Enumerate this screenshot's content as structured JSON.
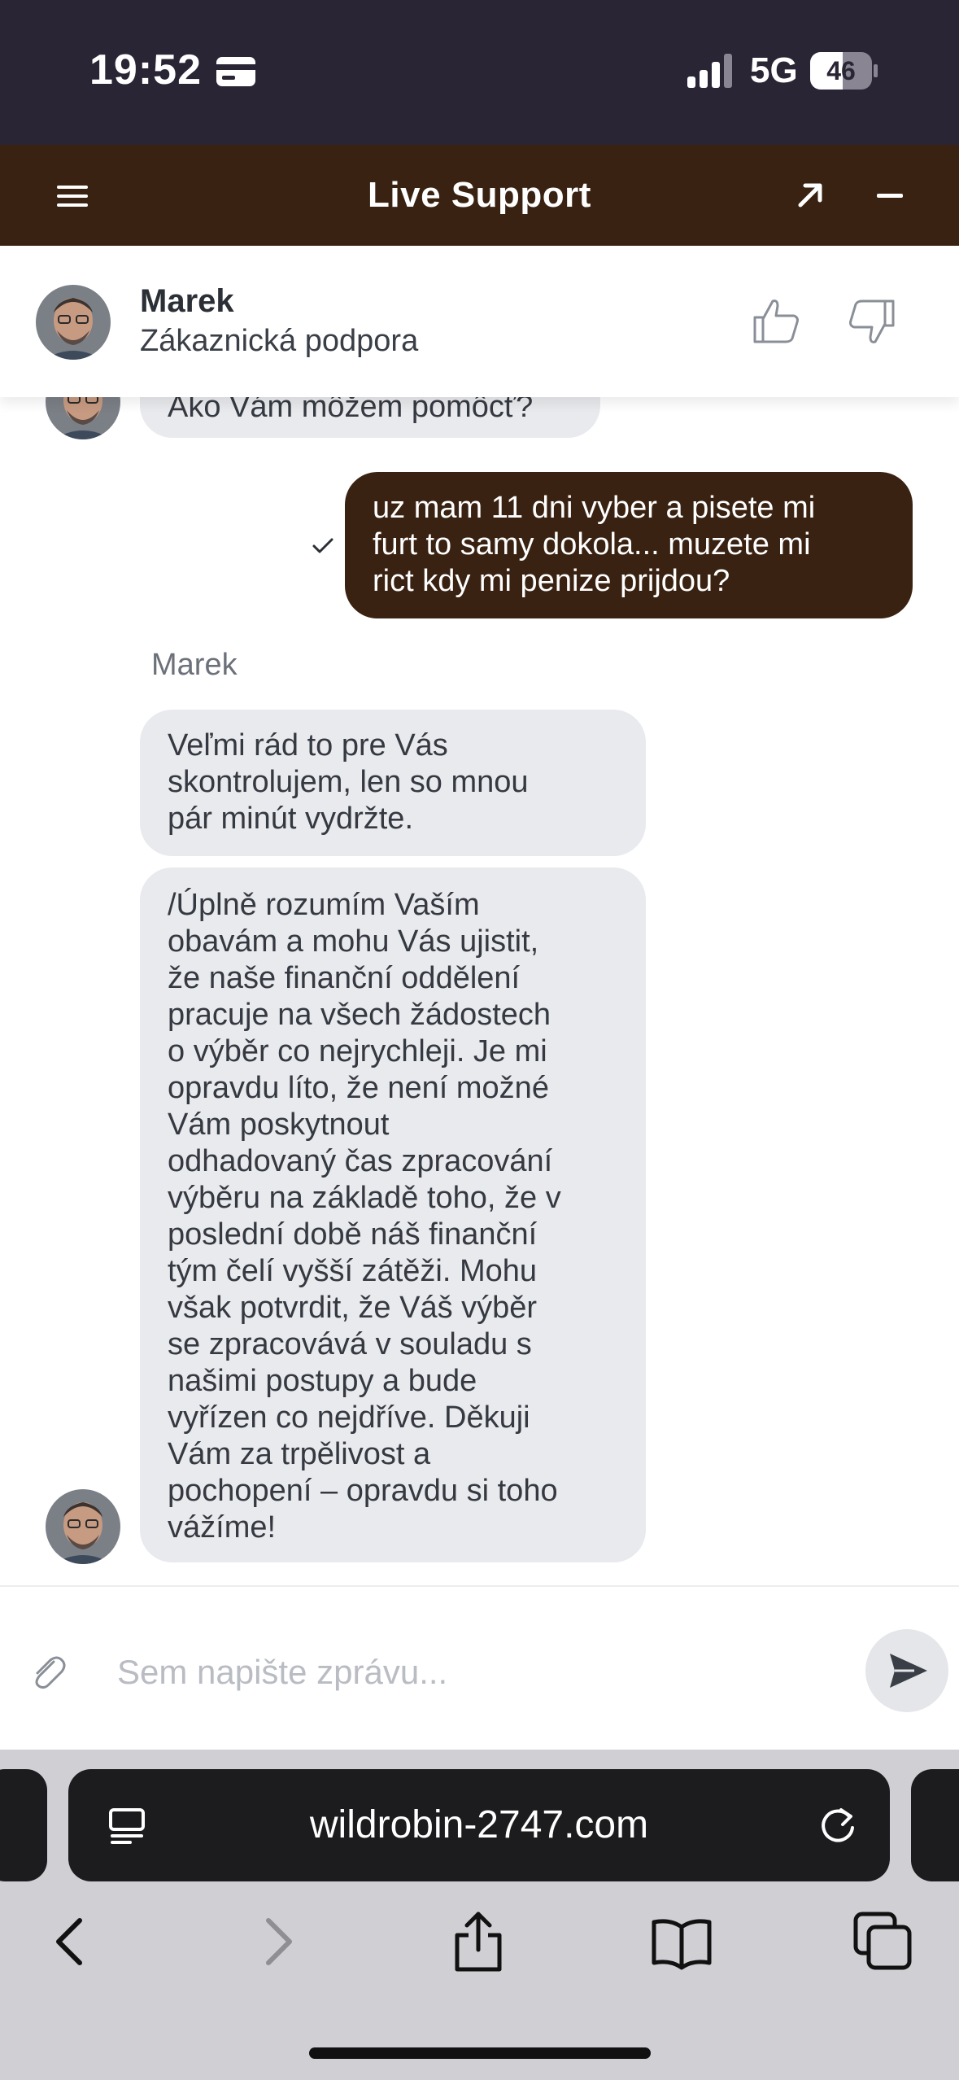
{
  "status_bar": {
    "time": "19:52",
    "network": "5G",
    "battery": "46"
  },
  "header": {
    "title": "Live Support"
  },
  "agent": {
    "name": "Marek",
    "role": "Zákaznická podpora"
  },
  "messages": {
    "agent_greeting": "Ako Vám môžem pomôcť?",
    "user_message": [
      "uz mam 11 dni vyber a pisete mi",
      "furt to samy dokola... muzete mi",
      "rict kdy mi penize prijdou?"
    ],
    "sender_label": "Marek",
    "agent_reply_1": [
      "Veľmi rád to pre Vás",
      "skontrolujem, len so mnou",
      "pár minút vydržte."
    ],
    "agent_reply_2": [
      "/Úplně rozumím Vaším",
      "obavám a mohu Vás ujistit,",
      "že naše finanční oddělení",
      "pracuje na všech žádostech",
      "o výběr co nejrychleji. Je mi",
      "opravdu líto, že není možné",
      "Vám poskytnout",
      "odhadovaný čas zpracování",
      "výběru na základě toho, že v",
      "poslední době náš finanční",
      "tým čelí vyšší zátěži. Mohu",
      "však potvrdit, že Váš výběr",
      "se zpracovává v souladu s",
      "našimi postupy a bude",
      "vyřízen co nejdříve. Děkuji",
      "Vám za trpělivost a",
      "pochopení – opravdu si toho",
      "vážíme!"
    ]
  },
  "composer": {
    "placeholder": "Sem napište zprávu..."
  },
  "browser": {
    "url": "wildrobin-2747.com"
  },
  "colors": {
    "status_bar_bg": "#2a2535",
    "header_bg": "#3a2212",
    "user_bubble": "#3a2212",
    "agent_bubble": "#e9eaed",
    "safari_bg": "#cfcfd4"
  }
}
